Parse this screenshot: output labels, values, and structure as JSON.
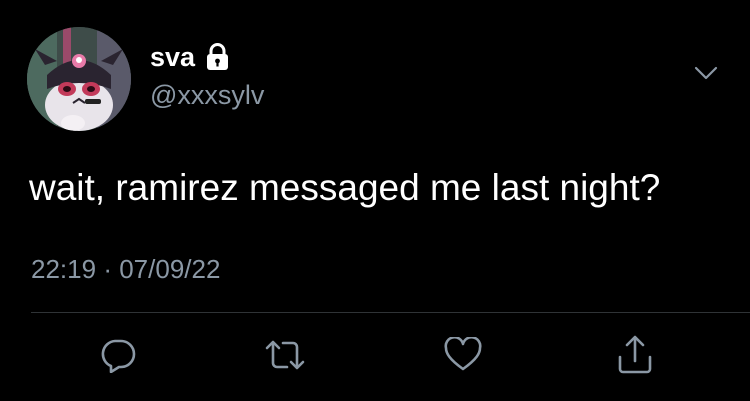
{
  "tweet": {
    "display_name": "sva",
    "handle": "@xxxsylv",
    "text": "wait, ramirez messaged me last night?",
    "time": "22:19",
    "separator": "·",
    "date": "07/09/22",
    "timestamp_full": "22:19 · 07/09/22"
  },
  "icons": {
    "lock": "lock-icon",
    "menu": "chevron-down-icon",
    "reply": "reply-icon",
    "retweet": "retweet-icon",
    "like": "heart-icon",
    "share": "share-icon"
  },
  "colors": {
    "background": "#000000",
    "primary_text": "#ffffff",
    "secondary_text": "#8b98a5",
    "divider": "#2f3336",
    "icon": "#8b98a5"
  }
}
